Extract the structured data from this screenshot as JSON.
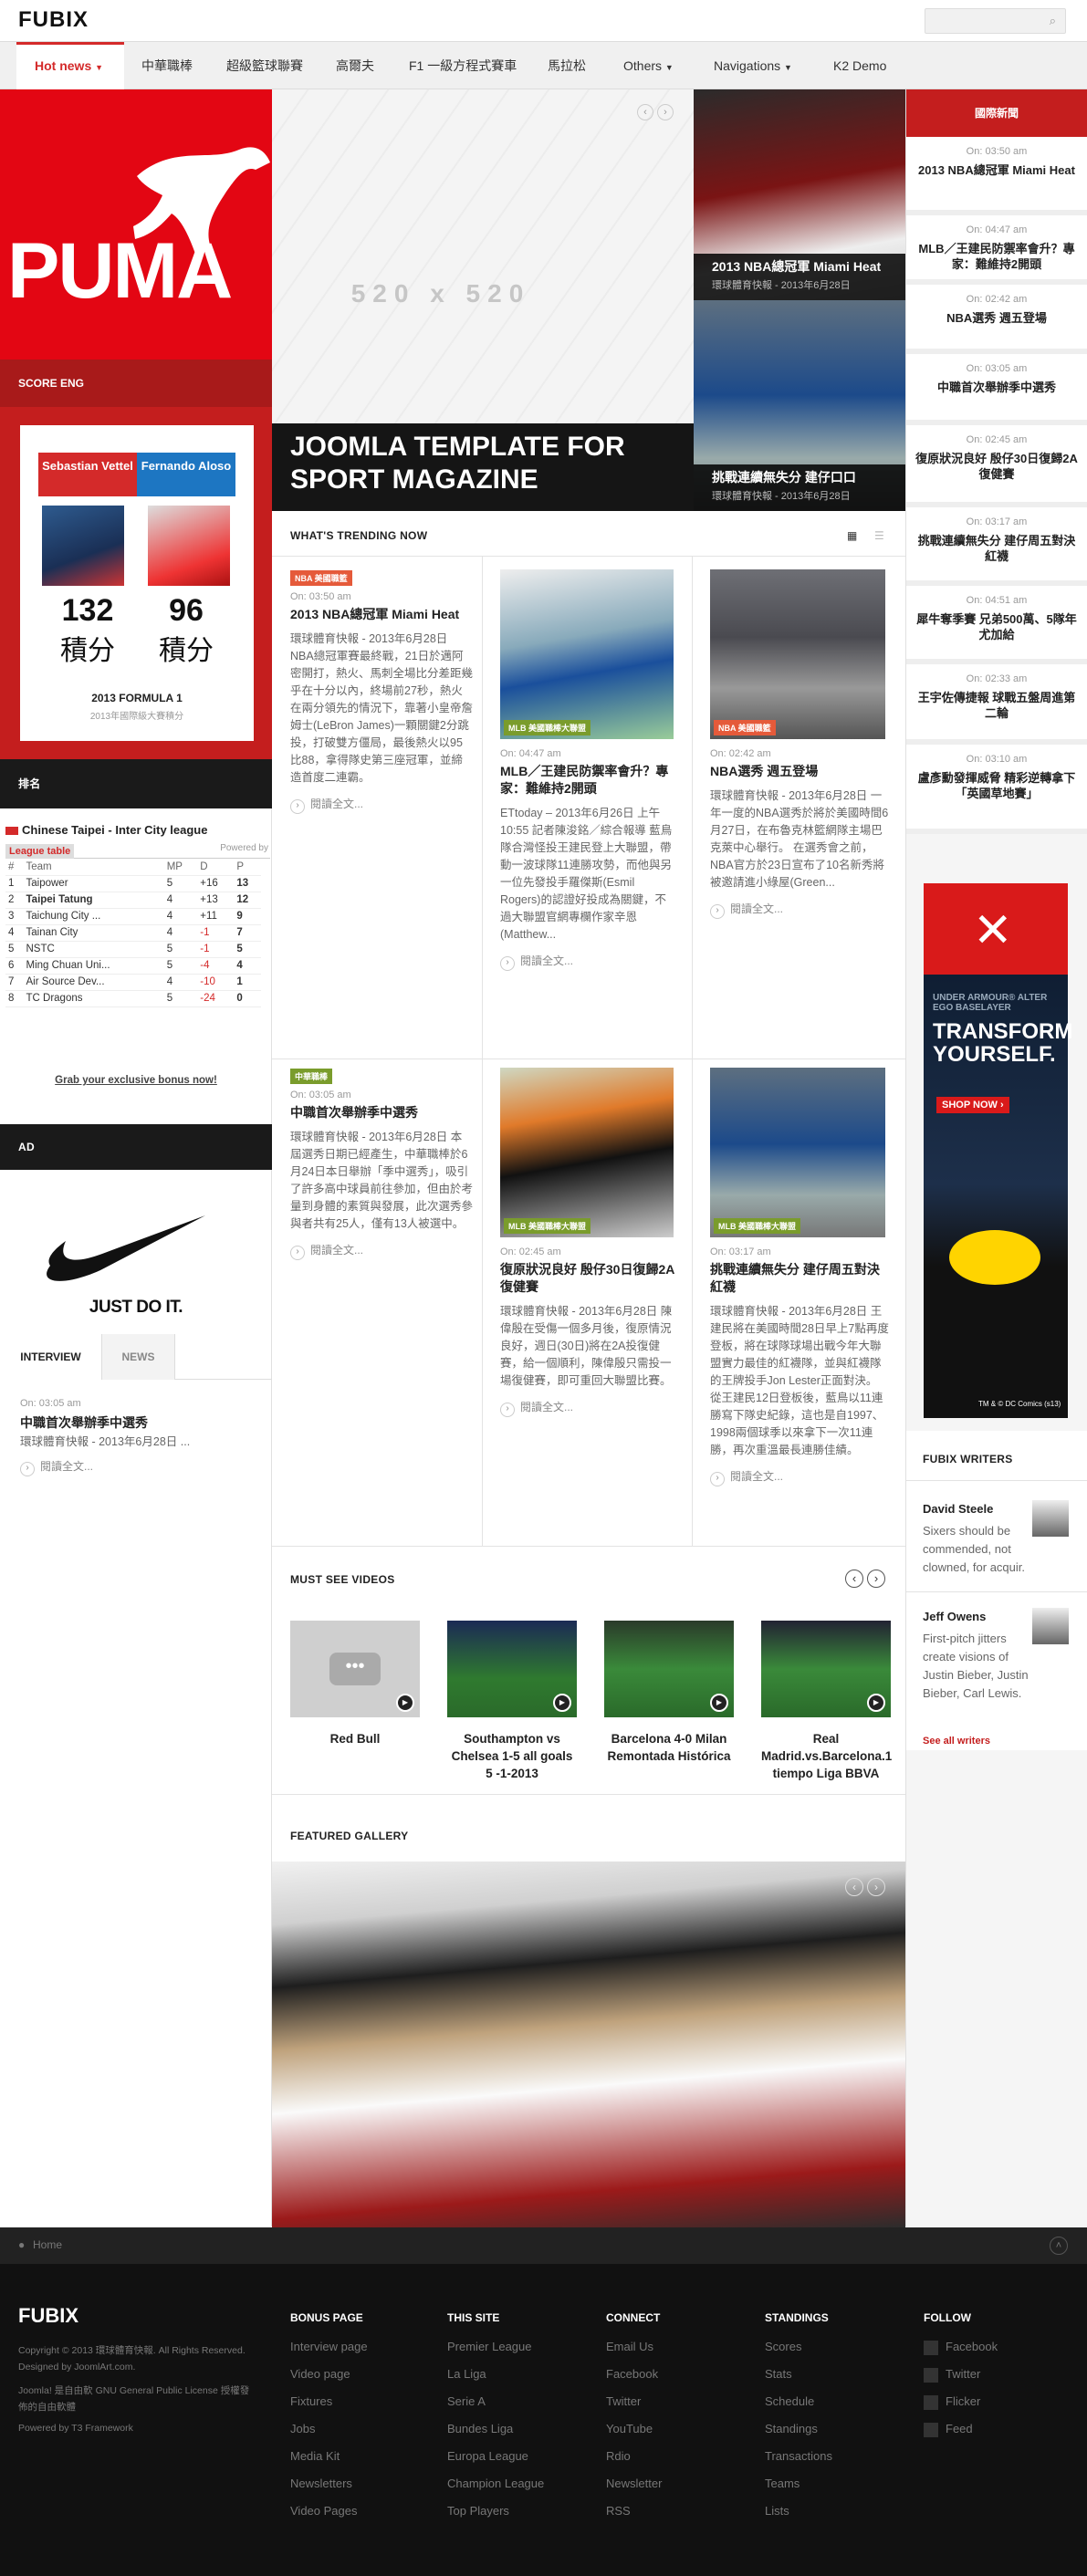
{
  "header": {
    "logo": "FUBIX",
    "search_icon": "search-icon"
  },
  "nav": {
    "items": [
      {
        "label": "Hot news",
        "active": true,
        "dropdown": true
      },
      {
        "label": "中華職棒"
      },
      {
        "label": "超級籃球聯賽"
      },
      {
        "label": "高爾夫"
      },
      {
        "label": "F1 一級方程式賽車"
      },
      {
        "label": "馬拉松"
      },
      {
        "label": "Others",
        "dropdown": true
      },
      {
        "label": "Navigations",
        "dropdown": true
      },
      {
        "label": "K2 Demo"
      }
    ]
  },
  "left": {
    "puma_text": "PUMA",
    "score_title": "SCORE ENG",
    "player1": "Sebastian Vettel",
    "player2": "Fernando Aloso",
    "score1": "132",
    "score2": "96",
    "unit": "積分",
    "event": "2013 FORMULA 1",
    "event_sub": "2013年國際級大賽積分",
    "rank_title": "排名",
    "league": "Chinese Taipei - Inter City league",
    "league_tab": "League table",
    "powered": "Powered by",
    "table_headers": [
      "#",
      "Team",
      "MP",
      "D",
      "P"
    ],
    "table": [
      [
        "1",
        "Taipower",
        "5",
        "+16",
        "13"
      ],
      [
        "2",
        "Taipei Tatung",
        "4",
        "+13",
        "12"
      ],
      [
        "3",
        "Taichung City ...",
        "4",
        "+11",
        "9"
      ],
      [
        "4",
        "Tainan City",
        "4",
        "-1",
        "7"
      ],
      [
        "5",
        "NSTC",
        "5",
        "-1",
        "5"
      ],
      [
        "6",
        "Ming Chuan Uni...",
        "5",
        "-4",
        "4"
      ],
      [
        "7",
        "Air Source Dev...",
        "4",
        "-10",
        "1"
      ],
      [
        "8",
        "TC Dragons",
        "5",
        "-24",
        "0"
      ]
    ],
    "bonus_link": "Grab your exclusive bonus now!",
    "ad_title": "AD",
    "nike_text": "JUST DO IT.",
    "tabs": [
      "INTERVIEW",
      "NEWS"
    ],
    "interview": {
      "time": "On: 03:05 am",
      "title": "中職首次舉辦季中選秀",
      "excerpt": "環球體育快報 - 2013年6月28日 ...",
      "more": "閱讀全文..."
    }
  },
  "hero": {
    "placeholder": "520 x 520",
    "title": "JOOMLA TEMPLATE FOR SPORT MAGAZINE"
  },
  "hero_side": [
    {
      "title": "2013 NBA總冠軍 Miami Heat",
      "date": "環球體育快報 - 2013年6月28日"
    },
    {
      "title": "挑戰連續無失分 建仔口口",
      "date": "環球體育快報 - 2013年6月28日"
    }
  ],
  "trending": {
    "title": "WHAT'S TRENDING NOW",
    "articles": [
      {
        "tag": "NBA 美國職籃",
        "time": "On: 03:50 am",
        "title": "2013 NBA總冠軍 Miami Heat",
        "excerpt": "環球體育快報 - 2013年6月28日 NBA總冠軍賽最終戰，21日於邁阿密開打，熱火、馬刺全場比分差距幾乎在十分以內，終場前27秒，熱火在兩分領先的情況下，靠著小皇帝詹姆士(LeBron James)一顆關鍵2分跳投，打破雙方僵局，最後熱火以95比88，拿得隊史第三座冠軍，並締造首度二連霸。",
        "more": "閱讀全文..."
      },
      {
        "tag": "MLB 美國職棒大聯盟",
        "time": "On: 04:47 am",
        "title": "MLB／王建民防禦率會升？專家：難維持2開頭",
        "excerpt": "ETtoday – 2013年6月26日 上午10:55 記者陳浚銘／綜合報導 藍鳥隊合灣怪投王建民登上大聯盟，帶動一波球隊11連勝攻勢，而他與另一位先發投手羅傑斯(Esmil Rogers)的認證好投成為關鍵，不過大聯盟官網專欄作家辛恩(Matthew...",
        "more": "閱讀全文..."
      },
      {
        "tag": "NBA 美國職籃",
        "time": "On: 02:42 am",
        "title": "NBA選秀 週五登場",
        "excerpt": "環球體育快報 - 2013年6月28日 一年一度的NBA選秀於將於美國時間6月27日，在布魯克林籃網隊主場巴克萊中心舉行。 在選秀會之前，NBA官方於23日宣布了10名新秀將被邀請進小綠屋(Green...",
        "more": "閱讀全文..."
      },
      {
        "tag": "中華職棒",
        "time": "On: 03:05 am",
        "title": "中職首次舉辦季中選秀",
        "excerpt": "環球體育快報 - 2013年6月28日 本屆選秀日期已經產生，中華職棒於6月24日本日舉辦「季中選秀」，吸引了許多高中球員前往參加，但由於考量到身體的素質與發展，此次選秀參與者共有25人，僅有13人被選中。",
        "more": "閱讀全文..."
      },
      {
        "tag": "MLB 美國職棒大聯盟",
        "time": "On: 02:45 am",
        "title": "復原狀況良好 殷仔30日復歸2A復健賽",
        "excerpt": "環球體育快報 - 2013年6月28日 陳偉殷在受傷一個多月後，復原情況良好，週日(30日)將在2A投復健賽，給一個順利，陳偉殷只需投一場復健賽，即可重回大聯盟比賽。",
        "more": "閱讀全文..."
      },
      {
        "tag": "MLB 美國職棒大聯盟",
        "time": "On: 03:17 am",
        "title": "挑戰連續無失分 建仔周五對決紅襪",
        "excerpt": "環球體育快報 - 2013年6月28日 王建民將在美國時間28日早上7點再度登板，將在球隊球場出戰今年大聯盟實力最佳的紅襪隊，並與紅襪隊的王牌投手Jon Lester正面對決。 從王建民12日登板後，藍鳥以11連勝寫下隊史紀錄，這也是自1997、1998兩個球季以來拿下一次11連勝，再次重溫最長連勝佳績。",
        "more": "閱讀全文..."
      }
    ]
  },
  "videos": {
    "title": "MUST SEE VIDEOS",
    "items": [
      {
        "caption": "Red Bull"
      },
      {
        "caption": "Southampton vs Chelsea 1-5 all goals 5 -1-2013"
      },
      {
        "caption": "Barcelona 4-0 Milan Remontada Histórica"
      },
      {
        "caption": "Real Madrid.vs.Barcelona.1 tiempo Liga BBVA"
      }
    ]
  },
  "gallery": {
    "title": "FEATURED GALLERY"
  },
  "right": {
    "title": "國際新聞",
    "items": [
      {
        "time": "On: 03:50 am",
        "title": "2013 NBA總冠軍 Miami Heat"
      },
      {
        "time": "On: 04:47 am",
        "title": "MLB／王建民防禦率會升？專家：難維持2開頭"
      },
      {
        "time": "On: 02:42 am",
        "title": "NBA選秀 週五登場"
      },
      {
        "time": "On: 03:05 am",
        "title": "中職首次舉辦季中選秀"
      },
      {
        "time": "On: 02:45 am",
        "title": "復原狀況良好 殷仔30日復歸2A復健賽"
      },
      {
        "time": "On: 03:17 am",
        "title": "挑戰連續無失分 建仔周五對決紅襪"
      },
      {
        "time": "On: 04:51 am",
        "title": "犀牛奪季賽 兄弟500萬、5隊年尤加給"
      },
      {
        "time": "On: 02:33 am",
        "title": "王宇佐傳捷報 球戰五盤周進第二輪"
      },
      {
        "time": "On: 03:10 am",
        "title": "盧彥勳發揮威脅 精彩逆轉拿下「英國草地賽」"
      }
    ],
    "ua_text1": "UNDER ARMOUR® ALTER EGO BASELAYER",
    "ua_text2": "TRANSFORM YOURSELF.",
    "ua_shop": "SHOP NOW ›",
    "ua_small": "TM & © DC Comics (s13)",
    "writers_title": "FUBIX WRITERS",
    "writers": [
      {
        "name": "David Steele",
        "quote": "Sixers should be commended, not clowned, for acquir."
      },
      {
        "name": "Jeff Owens",
        "quote": "First-pitch jitters create visions of Justin Bieber, Justin Bieber, Carl Lewis."
      }
    ],
    "all_writers": "See all writers"
  },
  "breadcrumb": {
    "home": "Home"
  },
  "footer": {
    "logo": "FUBIX",
    "copyright": "Copyright © 2013 環球體育快報. All Rights Reserved. Designed by JoomlArt.com.",
    "license": "Joomla! 是自由軟 GNU General Public License 授權發佈的自由軟體",
    "powered": "Powered by T3 Framework",
    "cols": [
      {
        "title": "BONUS PAGE",
        "items": [
          "Interview page",
          "Video page",
          "Fixtures",
          "Jobs",
          "Media Kit",
          "Newsletters",
          "Video Pages"
        ]
      },
      {
        "title": "THIS SITE",
        "items": [
          "Premier League",
          "La Liga",
          "Serie A",
          "Bundes Liga",
          "Europa League",
          "Champion League",
          "Top Players"
        ]
      },
      {
        "title": "CONNECT",
        "items": [
          "Email Us",
          "Facebook",
          "Twitter",
          "YouTube",
          "Rdio",
          "Newsletter",
          "RSS"
        ]
      },
      {
        "title": "STANDINGS",
        "items": [
          "Scores",
          "Stats",
          "Schedule",
          "Standings",
          "Transactions",
          "Teams",
          "Lists"
        ]
      },
      {
        "title": "FOLLOW",
        "items": [
          "Facebook",
          "Twitter",
          "Flicker",
          "Feed"
        ]
      }
    ]
  }
}
